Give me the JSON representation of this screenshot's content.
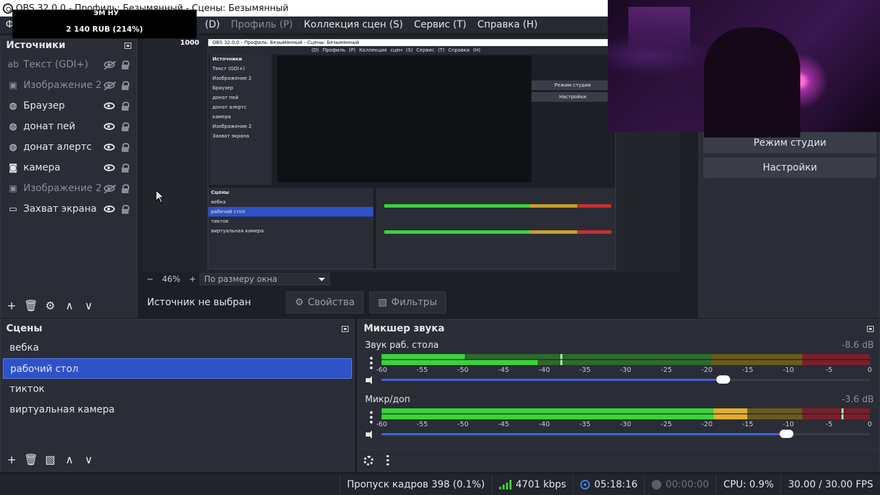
{
  "window": {
    "title": "OBS 32.0.0 - Профиль: Безымянный - Сцены: Безымянный"
  },
  "menu": {
    "first_fragment": "Ф",
    "items": [
      {
        "label": "(D)",
        "dim": false
      },
      {
        "label": "Профиль (P)",
        "dim": true
      },
      {
        "label": "Коллекция сцен (S)",
        "dim": false
      },
      {
        "label": "Сервис (T)",
        "dim": false
      },
      {
        "label": "Справка (H)",
        "dim": false
      }
    ]
  },
  "overlay": {
    "small_label": "ЭМ НУ",
    "amount": "2 140 RUB (214%)",
    "counter": "1000"
  },
  "sources": {
    "title": "Источники",
    "items": [
      {
        "label": "Текст (GDI+)",
        "icon": "text-icon",
        "glyph": "ab",
        "visible": false
      },
      {
        "label": "Изображение 2",
        "icon": "image-icon",
        "glyph": "▣",
        "visible": false
      },
      {
        "label": "Браузер",
        "icon": "globe-icon",
        "glyph": "◍",
        "visible": true
      },
      {
        "label": "донат пей",
        "icon": "globe-icon",
        "glyph": "◍",
        "visible": true
      },
      {
        "label": "донат алертс",
        "icon": "globe-icon",
        "glyph": "◍",
        "visible": true
      },
      {
        "label": "камера",
        "icon": "camera-icon",
        "glyph": "◙",
        "visible": true
      },
      {
        "label": "Изображение 2",
        "icon": "image-icon",
        "glyph": "▣",
        "visible": false
      },
      {
        "label": "Захват экрана",
        "icon": "monitor-icon",
        "glyph": "▭",
        "visible": true
      }
    ]
  },
  "preview": {
    "zoom_minus": "−",
    "zoom_value": "46%",
    "zoom_plus": "+",
    "zoom_mode": "По размеру окна",
    "nested": {
      "title": "OBS 32.0.0 - Профиль: Безымянный - Сцены: Безымянный",
      "menu": "(D)  Профиль (P)  Коллекция сцен (S)  Сервис (T)  Справка (H)",
      "sources_title": "Источники",
      "sources": [
        "Текст (GDI+)",
        "Изображение 2",
        "Браузер",
        "донат пей",
        "донат алертс",
        "камера",
        "Изображение 2",
        "Захват экрана"
      ],
      "scenes_title": "Сцены",
      "scenes": [
        "вебка",
        "рабочий стол",
        "тикток",
        "виртуальная камера"
      ],
      "controls": [
        "Режим студии",
        "Настройки"
      ]
    }
  },
  "selection": {
    "text": "Источник не выбран",
    "properties": "Свойства",
    "filters": "Фильтры"
  },
  "controls": {
    "studio_mode": "Режим студии",
    "settings": "Настройки"
  },
  "scenes": {
    "title": "Сцены",
    "items": [
      {
        "label": "вебка",
        "selected": false
      },
      {
        "label": "рабочий стол",
        "selected": true
      },
      {
        "label": "тикток",
        "selected": false
      },
      {
        "label": "виртуальная камера",
        "selected": false
      }
    ]
  },
  "mixer": {
    "title": "Микшер звука",
    "ticks": [
      "-60",
      "-55",
      "-50",
      "-45",
      "-40",
      "-35",
      "-30",
      "-25",
      "-20",
      "-15",
      "-10",
      "-5",
      "0"
    ],
    "channels": [
      {
        "name": "Звук раб. стола",
        "db": "-8.6 dB",
        "level_top": 0.17,
        "level_bottom": 0.32,
        "peak_db": -38,
        "volume": 0.7
      },
      {
        "name": "Микр/доп",
        "db": "-3.6 dB",
        "level_top": 0.68,
        "level_bottom": 0.68,
        "yellow_to": 0.75,
        "peak_db": -3.5,
        "volume": 0.83
      }
    ]
  },
  "status": {
    "dropped_frames": "Пропуск кадров 398 (0.1%)",
    "bitrate": "4701 kbps",
    "stream_time": "05:18:16",
    "rec_time": "00:00:00",
    "cpu": "CPU: 0.9%",
    "fps": "30.00 / 30.00 FPS"
  },
  "colors": {
    "accent": "#2f52c8",
    "meter_green": "#3ad33a",
    "meter_yellow": "#e0b030",
    "meter_red": "#c83030",
    "volume_blue": "#3f66e0"
  }
}
